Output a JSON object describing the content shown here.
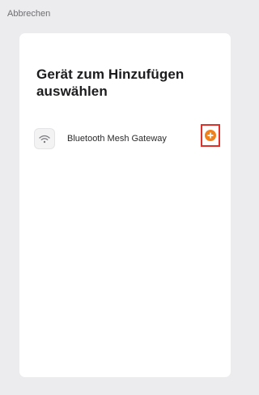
{
  "header": {
    "cancel_label": "Abbrechen"
  },
  "card": {
    "title": "Gerät zum Hinzufügen auswählen",
    "devices": [
      {
        "name": "Bluetooth Mesh Gateway",
        "icon": "wifi-icon",
        "action_icon": "add-circle-icon"
      }
    ]
  },
  "colors": {
    "accent": "#f0821e",
    "highlight_border": "#e0302a",
    "background": "#ececee",
    "card": "#ffffff"
  }
}
